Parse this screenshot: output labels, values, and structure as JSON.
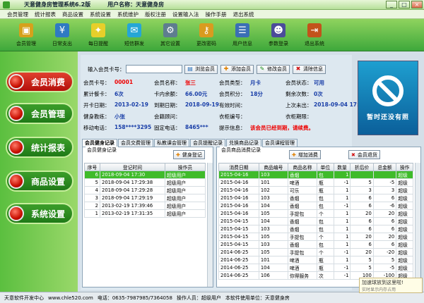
{
  "window": {
    "title": "天意健身房管理系统6.2版",
    "user_label": "用户名称：天意健身房"
  },
  "menu": [
    "会员管理",
    "统计报表",
    "商品设置",
    "系统设置",
    "系统维护",
    "版权注册",
    "设置输入法",
    "操作手册",
    "退出系统"
  ],
  "toolbar": [
    {
      "label": "会员管理",
      "icon": "gift-icon",
      "color": "#d6a11b"
    },
    {
      "label": "日常支出",
      "icon": "money-icon",
      "color": "#2f7ac2"
    },
    {
      "label": "每日提醒",
      "icon": "bulb-icon",
      "color": "#e7cf2a"
    },
    {
      "label": "短信群发",
      "icon": "sms-icon",
      "color": "#25a6d6"
    },
    {
      "label": "其它设置",
      "icon": "settings-icon",
      "color": "#5e7d8f"
    },
    {
      "label": "更改密码",
      "icon": "key-icon",
      "color": "#d99b1f"
    },
    {
      "label": "用户信息",
      "icon": "user-info-icon",
      "color": "#3a6fb5"
    },
    {
      "label": "参数登录",
      "icon": "login-icon",
      "color": "#4b4b9a"
    },
    {
      "label": "退出系统",
      "icon": "exit-icon",
      "color": "#c2531b"
    }
  ],
  "sidebar": [
    "会员消费",
    "会员管理",
    "统计报表",
    "商品设置",
    "系统设置"
  ],
  "search": {
    "label": "输入会员卡号：",
    "value": "",
    "btn_browse": "浏览会员",
    "btn_add": "添加会员",
    "btn_edit": "修改会员",
    "btn_clear": "清除信息"
  },
  "member": {
    "card_no_label": "会员卡号：",
    "card_no": "00001",
    "name_label": "会员名称：",
    "name": "张三",
    "type_label": "会员类型：",
    "type": "月卡",
    "status_label": "会员状态：",
    "status": "可用",
    "total_count_label": "累计餐卡：",
    "total_count": "6次",
    "balance_label": "卡内余额：",
    "balance": "66.00元",
    "points_label": "会员积分：",
    "points": "18分",
    "remain_label": "剩余次数：",
    "remain": "0次",
    "open_date_label": "开卡日期：",
    "open_date": "2013-02-19",
    "expire_label": "到期日期：",
    "expire": "2018-09-19",
    "valid_label": "有效时间：",
    "valid": "",
    "last_label": "上次未出：",
    "last": "2018-09-04 17:30",
    "coach_label": "健身教练：",
    "coach": "小张",
    "consultant_label": "会籍顾问：",
    "consultant": "",
    "locker_label": "衣柜编号：",
    "locker": "",
    "locker_exp_label": "衣柜期限：",
    "locker_exp": "",
    "mobile_label": "移动电话：",
    "mobile": "158****3295",
    "phone_label": "固定电话：",
    "phone": "8465***",
    "notice_label": "提示信息：",
    "notice": "该会员已经到期，请续费。",
    "photo_caption": "暂时还没有照"
  },
  "tabs": [
    "会员健身记录",
    "会员交费管理",
    "私教课会管理",
    "会员提醒记录",
    "兑换商品记录",
    "会员课程管理"
  ],
  "left_panel": {
    "title": "会员健身记录",
    "btn": "健身登记",
    "columns": [
      "序号",
      "登记时间",
      "操作员"
    ],
    "rows": [
      [
        "6",
        "2018-09-04 17:30",
        "超级用户"
      ],
      [
        "5",
        "2018-09-04 17:29:38",
        "超级用户"
      ],
      [
        "4",
        "2018-09-04 17:29:28",
        "超级用户"
      ],
      [
        "3",
        "2018-09-04 17:29:19",
        "超级用户"
      ],
      [
        "2",
        "2013-02-19 17:39:46",
        "超级用户"
      ],
      [
        "1",
        "2013-02-19 17:31:35",
        "超级用户"
      ]
    ]
  },
  "right_panel": {
    "title": "会员商品消费记录",
    "btn_add": "增加消费",
    "btn_return": "会员退货",
    "columns": [
      "消费日期",
      "商品编号",
      "商品名称",
      "单位",
      "数量",
      "折后价",
      "总金额",
      "操作"
    ],
    "rows": [
      [
        "2015-04-16",
        "103",
        "香烟",
        "包",
        "1",
        "",
        "",
        "超级"
      ],
      [
        "2015-04-16",
        "101",
        "啤酒",
        "瓶",
        "-1",
        "5",
        "-5",
        "超级"
      ],
      [
        "2015-04-16",
        "102",
        "可乐",
        "瓶",
        "1",
        "3",
        "3",
        "超级"
      ],
      [
        "2015-04-16",
        "103",
        "香烟",
        "包",
        "1",
        "6",
        "6",
        "超级"
      ],
      [
        "2015-04-16",
        "104",
        "香烟",
        "包",
        "-1",
        "6",
        "-6",
        "超级"
      ],
      [
        "2015-04-16",
        "105",
        "手提包",
        "个",
        "1",
        "20",
        "20",
        "超级"
      ],
      [
        "2015-04-15",
        "104",
        "香烟",
        "包",
        "1",
        "6",
        "6",
        "超级"
      ],
      [
        "2015-04-15",
        "103",
        "香烟",
        "包",
        "1",
        "6",
        "6",
        "超级"
      ],
      [
        "2015-04-15",
        "105",
        "手提包",
        "个",
        "1",
        "20",
        "20",
        "超级"
      ],
      [
        "2015-04-15",
        "103",
        "香烟",
        "包",
        "1",
        "6",
        "6",
        "超级"
      ],
      [
        "2014-06-25",
        "105",
        "手提包",
        "个",
        "-1",
        "20",
        "-20",
        "超级"
      ],
      [
        "2014-06-25",
        "101",
        "啤酒",
        "瓶",
        "1",
        "5",
        "5",
        "超级"
      ],
      [
        "2014-06-25",
        "104",
        "啤酒",
        "瓶",
        "-1",
        "5",
        "-5",
        "超级"
      ],
      [
        "2014-06-25",
        "106",
        "你得服务",
        "次",
        "-1",
        "100",
        "-100",
        "超级"
      ]
    ]
  },
  "status": {
    "dev": "天意软件开发中心",
    "site": "www.chle520.com",
    "phone": "电话：0635-7987985/7364058",
    "operator": "操作人员：超级用户",
    "licensee": "本软件使用单位：天意健身房"
  },
  "toast": {
    "line1": "加速球放到这里啦!",
    "line2": "实时显示内存占用"
  }
}
